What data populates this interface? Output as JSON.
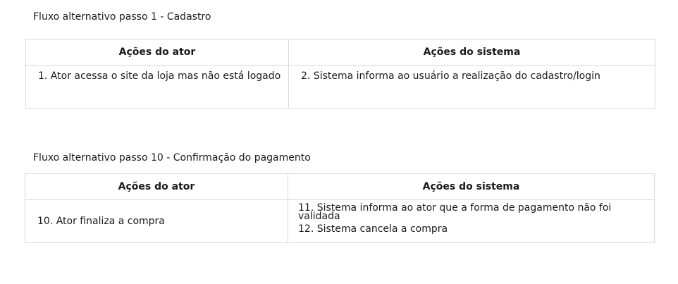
{
  "flow1": {
    "title": "Fluxo alternativo passo 1 - Cadastro",
    "header_actor": "Ações do ator",
    "header_system": "Ações do sistema",
    "actor_step": "1. Ator acessa o site da loja mas não está logado",
    "system_steps": [
      "2. Sistema informa ao usuário a realização do cadastro/login"
    ]
  },
  "flow2": {
    "title": "Fluxo alternativo passo 10 - Confirmação do pagamento",
    "header_actor": "Ações do ator",
    "header_system": "Ações do sistema",
    "actor_step": "10. Ator finaliza a compra",
    "system_steps": [
      "11. Sistema informa ao ator que a forma de pagamento não foi validada",
      "12. Sistema cancela a compra"
    ]
  }
}
